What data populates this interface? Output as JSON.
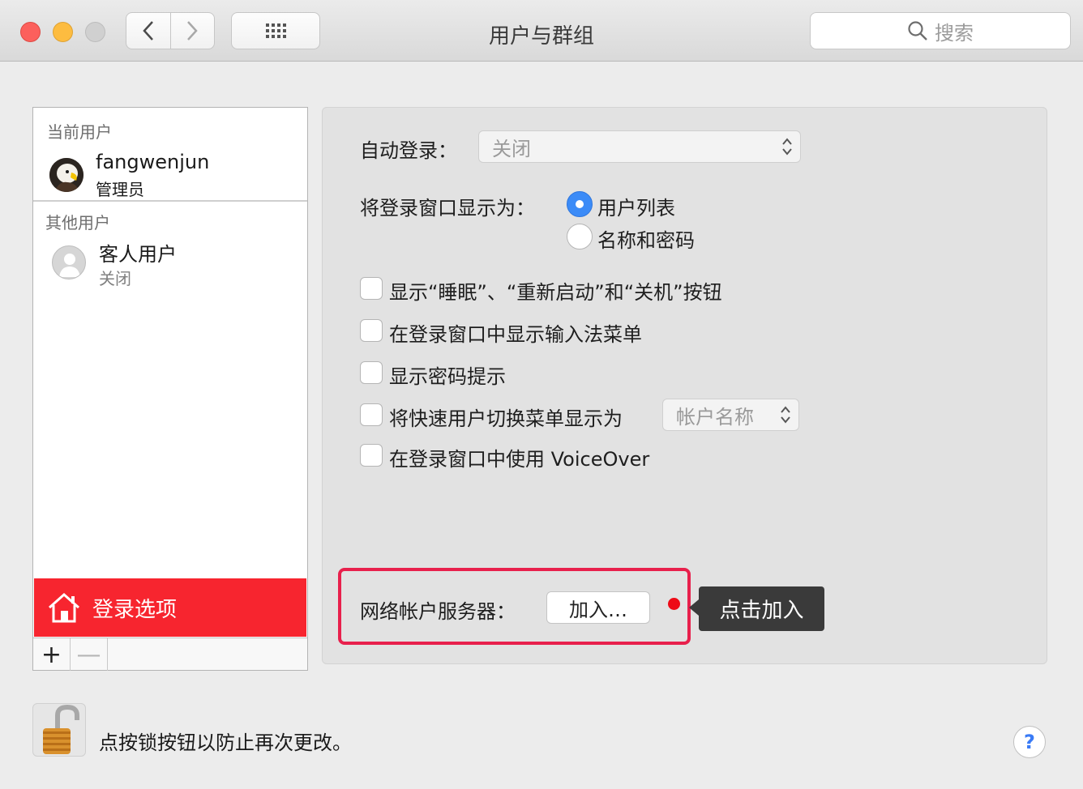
{
  "window": {
    "title": "用户与群组"
  },
  "toolbar": {
    "back_icon": "chevron-left-icon",
    "forward_icon": "chevron-right-icon",
    "grid_icon": "grid-icon",
    "search_placeholder": "搜索"
  },
  "sidebar": {
    "current_section": "当前用户",
    "current_user": {
      "name": "fangwenjun",
      "role": "管理员"
    },
    "other_section": "其他用户",
    "guest_user": {
      "name": "客人用户",
      "status": "关闭"
    },
    "login_options": "登录选项",
    "add": "+",
    "remove": "—"
  },
  "main": {
    "auto_login_label": "自动登录：",
    "auto_login_value": "关闭",
    "display_login_label": "将登录窗口显示为：",
    "radio_list": "用户列表",
    "radio_name_pw": "名称和密码",
    "chk_sleep": "显示“睡眠”、“重新启动”和“关机”按钮",
    "chk_input_menu": "在登录窗口中显示输入法菜单",
    "chk_pw_hint": "显示密码提示",
    "chk_fast_switch": "将快速用户切换菜单显示为",
    "fast_switch_value": "帐户名称",
    "chk_voiceover": "在登录窗口中使用 VoiceOver",
    "network_label": "网络帐户服务器：",
    "join_button": "加入…",
    "tooltip": "点击加入"
  },
  "footer": {
    "lock_text": "点按锁按钮以防止再次更改。",
    "help": "?"
  },
  "colors": {
    "accent": "#3b8bf7",
    "highlight_red": "#f7252f",
    "annotation_box": "#e8204c"
  }
}
